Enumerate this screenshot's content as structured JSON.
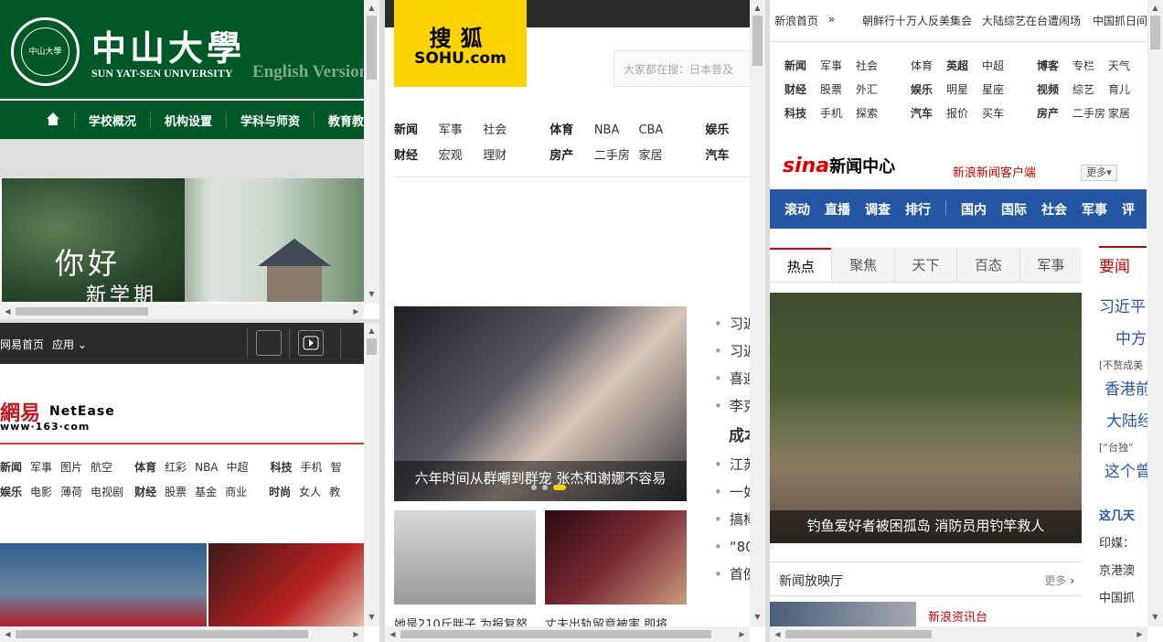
{
  "sysu": {
    "seal_text": "中山大學",
    "title_cn": "中山大學",
    "title_en": "SUN YAT-SEN UNIVERSITY",
    "english_version": "English Version",
    "nav": [
      "学校概况",
      "机构设置",
      "学科与师资",
      "教育教"
    ],
    "banner_line1": "你好",
    "banner_line2": "新学期"
  },
  "netease": {
    "top_home": "网易首页",
    "top_apps": "应用",
    "logo_cn": "網易",
    "logo_en": "NetEase",
    "logo_www": "www·163·com",
    "nav_row1": [
      "新闻",
      "军事",
      "图片",
      "航空",
      "体育",
      "红彩",
      "NBA",
      "中超",
      "科技",
      "手机",
      "智"
    ],
    "nav_row2": [
      "娱乐",
      "电影",
      "薄荷",
      "电视剧",
      "财经",
      "股票",
      "基金",
      "商业",
      "时尚",
      "女人",
      "教"
    ]
  },
  "sohu": {
    "logo_cn": "搜狐",
    "logo_en": "SOHU.com",
    "search_placeholder": "大家都在搜：日本普及",
    "nav_row1": [
      "新闻",
      "军事",
      "社会",
      "体育",
      "NBA",
      "CBA",
      "娱乐"
    ],
    "nav_row2": [
      "财经",
      "宏观",
      "理财",
      "房产",
      "二手房",
      "家居",
      "汽车"
    ],
    "feature_caption": "六年时间从群嘲到群宠 张杰和谢娜不容易",
    "thumb1_caption": "她是210斤胖子 为报复怒",
    "thumb2_caption": "丈夫出轨留意被害 即将",
    "list": [
      "习近",
      "习近",
      "喜迎",
      "李克",
      "成本",
      "江苏",
      "一如",
      "搞棒",
      "“80",
      "首例"
    ]
  },
  "sina": {
    "top": [
      "新浪首页",
      "朝鲜行十万人反美集会",
      "大陆综艺在台遭闹场",
      "中国抓日间"
    ],
    "nav_row1": [
      "新闻",
      "军事",
      "社会",
      "体育",
      "英超",
      "中超",
      "博客",
      "专栏",
      "天气"
    ],
    "nav_row2": [
      "财经",
      "股票",
      "外汇",
      "娱乐",
      "明星",
      "星座",
      "视频",
      "综艺",
      "育儿"
    ],
    "nav_row3": [
      "科技",
      "手机",
      "探索",
      "汽车",
      "报价",
      "买车",
      "房产",
      "二手房",
      "家居"
    ],
    "logo": "sina",
    "logo_title": "新闻中心",
    "client_link": "新浪新闻客户端",
    "more_label": "更多",
    "blue_nav": [
      "滚动",
      "直播",
      "调查",
      "排行",
      "国内",
      "国际",
      "社会",
      "军事",
      "评"
    ],
    "tabs": [
      "热点",
      "聚焦",
      "天下",
      "百态",
      "军事"
    ],
    "photo_caption": "钓鱼爱好者被困孤岛 消防员用钓竿救人",
    "cinema_title": "新闻放映厅",
    "cinema_more": "更多",
    "zixun": "新浪资讯台",
    "right_header": "要闻",
    "right_items": [
      "习近平",
      "中方",
      "[不赘成美",
      "香港前",
      "大陆经",
      "[“台独”",
      "这个曾"
    ],
    "right_dots": [
      "这几天",
      "印媒：",
      "京港澳",
      "中国抓"
    ]
  }
}
